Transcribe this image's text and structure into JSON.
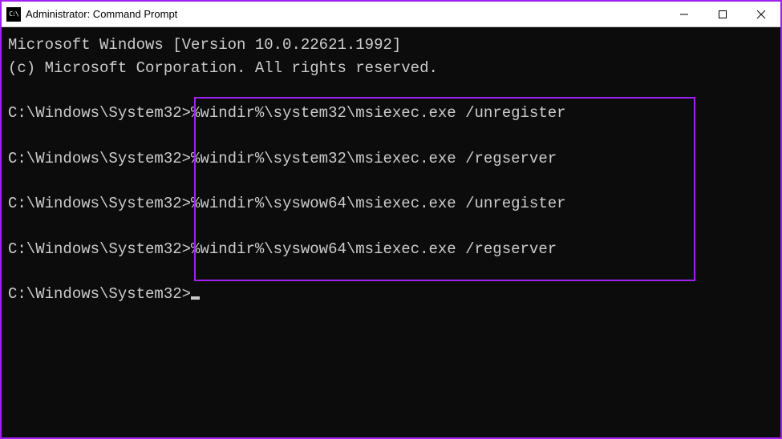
{
  "window": {
    "title": "Administrator: Command Prompt"
  },
  "terminal": {
    "header1": "Microsoft Windows [Version 10.0.22621.1992]",
    "header2": "(c) Microsoft Corporation. All rights reserved.",
    "prompt": "C:\\Windows\\System32>",
    "lines": [
      {
        "cmd": "%windir%\\system32\\msiexec.exe /unregister"
      },
      {
        "cmd": "%windir%\\system32\\msiexec.exe /regserver"
      },
      {
        "cmd": "%windir%\\syswow64\\msiexec.exe /unregister"
      },
      {
        "cmd": "%windir%\\syswow64\\msiexec.exe /regserver"
      }
    ]
  }
}
